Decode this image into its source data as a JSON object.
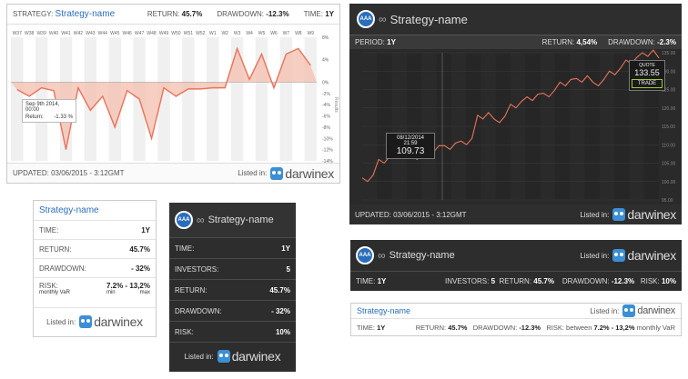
{
  "w1": {
    "strategy_label": "STRATEGY:",
    "strategy_name": "Strategy-name",
    "return_label": "RETURN:",
    "return_value": "45.7%",
    "drawdown_label": "DRAWDOWN:",
    "drawdown_value": "-12.3%",
    "time_label": "TIME:",
    "time_value": "1Y",
    "weeks": [
      "W37",
      "W38",
      "W39",
      "W40",
      "W41",
      "W42",
      "W43",
      "W44",
      "W45",
      "W46",
      "W47",
      "W48",
      "W49",
      "W50",
      "W51",
      "W52",
      "W1",
      "W2",
      "W3",
      "W4",
      "W5",
      "W6",
      "W7",
      "W8",
      "W9"
    ],
    "y_ticks": [
      "8%",
      "4%",
      "0%",
      "-2%",
      "-4%",
      "-6%",
      "-8%",
      "-10%",
      "-12%",
      "-14%"
    ],
    "y_axis_title": "Results",
    "tooltip_date": "Sep 9th 2014, 00:00",
    "tooltip_label": "Return:",
    "tooltip_value": "-1.33 %",
    "updated": "UPDATED: 03/06/2015 - 3:12GMT",
    "listed_in": "Listed in:",
    "brand": "darwinex"
  },
  "w2": {
    "avatar": "AAA",
    "name": "Strategy-name",
    "period_label": "PERIOD:",
    "period_value": "1Y",
    "return_label": "RETURN:",
    "return_value": "4,54%",
    "drawdown_label": "DRAWDOWN:",
    "drawdown_value": "-2.3%",
    "tooltip_date": "08/12/2014 21:59",
    "tooltip_value": "109.73",
    "quote_label": "QUOTE",
    "quote_value": "133.55",
    "trade_label": "TRADE",
    "y_ticks": [
      "135.00",
      "130.00",
      "125.00",
      "120.00",
      "115.00",
      "110.00",
      "105.00",
      "100.00",
      "95.00"
    ],
    "updated": "UPDATED: 03/06/2015 - 3:12GMT",
    "listed_in": "Listed in:",
    "brand": "darwinex"
  },
  "w3": {
    "title": "Strategy-name",
    "time_label": "TIME:",
    "time_value": "1Y",
    "return_label": "RETURN:",
    "return_value": "45.7%",
    "drawdown_label": "DRAWDOWN:",
    "drawdown_value": "- 32%",
    "risk_label": "RISK:",
    "risk_sub": "monthly VaR",
    "risk_value": "7.2% - 13,2%",
    "risk_min": "min",
    "risk_max": "max",
    "listed_in": "Listed in:",
    "brand": "darwinex"
  },
  "w4": {
    "avatar": "AAA",
    "name": "Strategy-name",
    "rows": [
      {
        "label": "TIME:",
        "value": "1Y"
      },
      {
        "label": "INVESTORS:",
        "value": "5"
      },
      {
        "label": "RETURN:",
        "value": "45.7%"
      },
      {
        "label": "DRAWDOWN:",
        "value": "- 32%"
      },
      {
        "label": "RISK:",
        "value": "10%"
      }
    ],
    "listed_in": "Listed in:",
    "brand": "darwinex"
  },
  "w5": {
    "avatar": "AAA",
    "name": "Strategy-name",
    "listed_in": "Listed in:",
    "brand": "darwinex",
    "time_label": "TIME:",
    "time_value": "1Y",
    "investors_label": "INVESTORS:",
    "investors_value": "5",
    "return_label": "RETURN:",
    "return_value": "45.7%",
    "drawdown_label": "DRAWDOWN:",
    "drawdown_value": "-12.3%",
    "risk_label": "RISK:",
    "risk_value": "10%"
  },
  "w6": {
    "name": "Strategy-name",
    "listed_in": "Listed in:",
    "brand": "darwinex",
    "time_label": "TIME:",
    "time_value": "1Y",
    "return_label": "RETURN:",
    "return_value": "45.7%",
    "drawdown_label": "DRAWDOWN:",
    "drawdown_value": "-12.3%",
    "risk_label": "RISK:",
    "risk_between": "between",
    "risk_value": "7.2% - 13,2%",
    "risk_sub": "monthly VaR"
  },
  "chart_data": [
    {
      "type": "area",
      "x": [
        "W37",
        "W38",
        "W39",
        "W40",
        "W41",
        "W42",
        "W43",
        "W44",
        "W45",
        "W46",
        "W47",
        "W48",
        "W49",
        "W50",
        "W51",
        "W52",
        "W1",
        "W2",
        "W3",
        "W4",
        "W5",
        "W6",
        "W7",
        "W8",
        "W9"
      ],
      "y_ticks": [
        "8%",
        "4%",
        "0%",
        "-2%",
        "-4%",
        "-6%",
        "-8%",
        "-10%",
        "-12%",
        "-14%"
      ],
      "y_axis_title": "Results",
      "values": [
        -1.3,
        -2.5,
        -1.0,
        -1.5,
        -12,
        -1.0,
        -5,
        -2.5,
        -8,
        -1.5,
        -3,
        -10,
        -1,
        -2.5,
        -1.2,
        -1.2,
        -1.0,
        -1.0,
        6,
        0.5,
        5,
        -1,
        5,
        6,
        3
      ],
      "ylim": [
        -14,
        8
      ]
    },
    {
      "type": "line",
      "y_ticks": [
        "135.00",
        "130.00",
        "125.00",
        "120.00",
        "115.00",
        "110.00",
        "105.00",
        "100.00",
        "95.00"
      ],
      "values": [
        101,
        106,
        108,
        107,
        109,
        109.73,
        111,
        118,
        117,
        121,
        123,
        124,
        127,
        128,
        127,
        130,
        133,
        135,
        133.55
      ],
      "ylim": [
        95,
        135
      ]
    }
  ],
  "colors": {
    "accent_blue": "#2a6ebb",
    "chart_line": "#e8735a",
    "chart_fill": "#f5c2b3"
  }
}
